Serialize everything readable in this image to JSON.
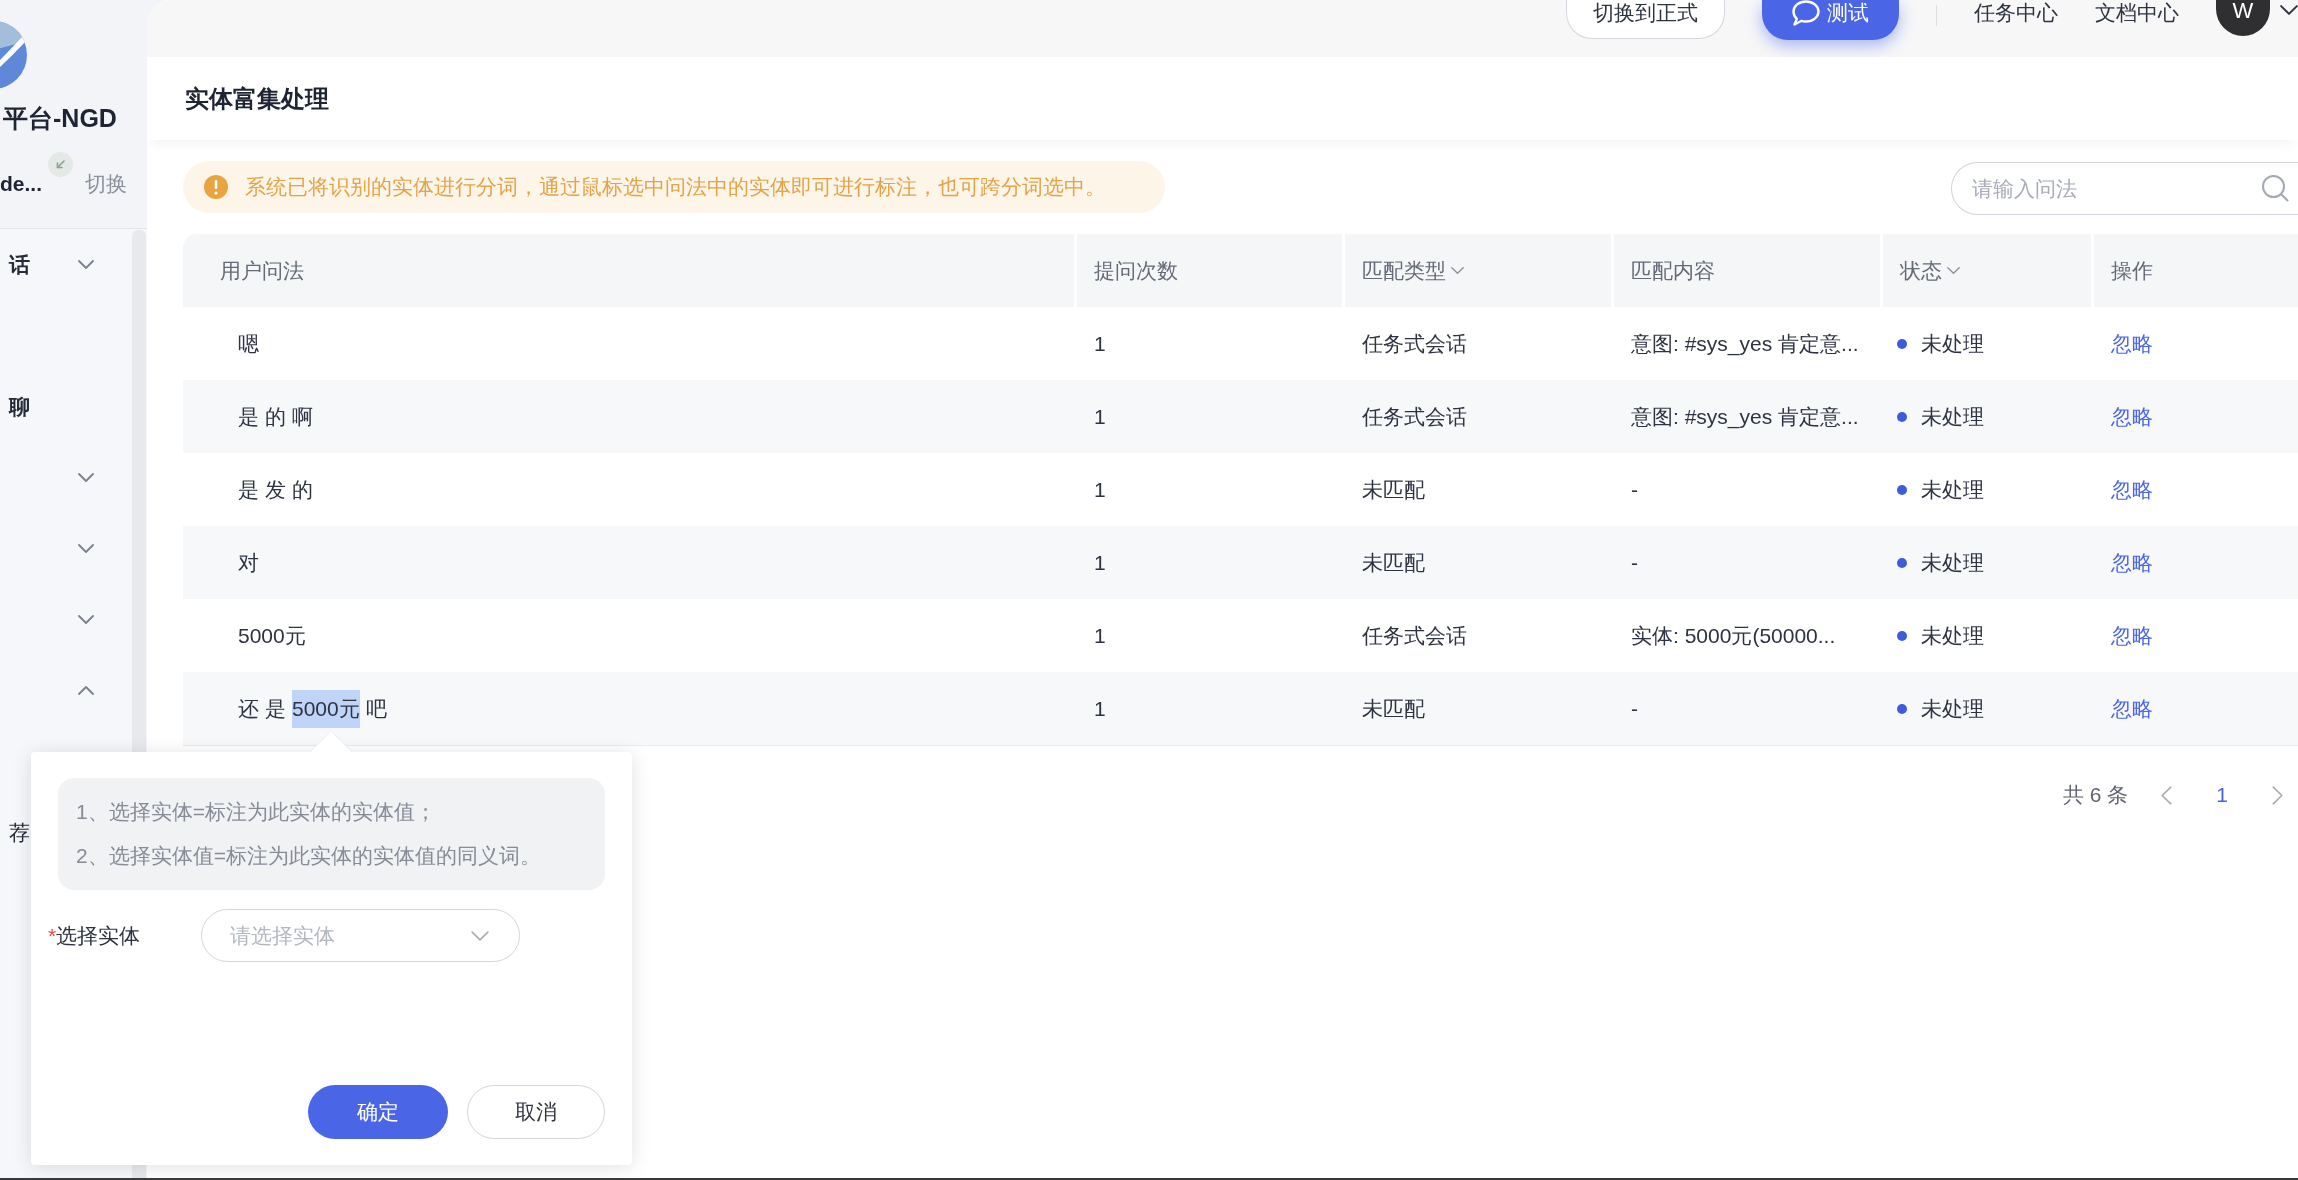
{
  "sidebar": {
    "app_name": "平台-NGD",
    "bot_name": "de...",
    "switch_label": "切换",
    "menu": [
      {
        "label": "话",
        "expanded": false
      },
      {
        "label": "聊"
      },
      {
        "expanded": false
      },
      {
        "expanded": false
      },
      {
        "expanded": false
      },
      {
        "expanded": true,
        "children": [
          {
            "label": "荐"
          }
        ]
      }
    ]
  },
  "header": {
    "buttons": [
      {
        "label": "切换到正式",
        "kind": "outline"
      },
      {
        "label": "测试",
        "kind": "primary"
      }
    ],
    "links": [
      "任务中心",
      "文档中心"
    ],
    "avatar": "W"
  },
  "page": {
    "title": "实体富集处理",
    "notice": "系统已将识别的实体进行分词，通过鼠标选中问法中的实体即可进行标注，也可跨分词选中。",
    "search": {
      "placeholder": "请输入问法"
    }
  },
  "table": {
    "columns": [
      {
        "label": "用户问法",
        "filter": false
      },
      {
        "label": "提问次数",
        "filter": false
      },
      {
        "label": "匹配类型",
        "filter": true
      },
      {
        "label": "匹配内容",
        "filter": false
      },
      {
        "label": "状态",
        "filter": true
      },
      {
        "label": "操作",
        "filter": false
      }
    ],
    "rows": [
      {
        "tokens": [
          {
            "text": "嗯",
            "selected": false
          }
        ],
        "count": "1",
        "match_type": "任务式会话",
        "match_content": "意图: #sys_yes 肯定意...",
        "status": "未处理",
        "action": "忽略"
      },
      {
        "tokens": [
          {
            "text": "是",
            "selected": false
          },
          {
            "text": "的",
            "selected": false
          },
          {
            "text": "啊",
            "selected": false
          }
        ],
        "count": "1",
        "match_type": "任务式会话",
        "match_content": "意图: #sys_yes 肯定意...",
        "status": "未处理",
        "action": "忽略"
      },
      {
        "tokens": [
          {
            "text": "是",
            "selected": false
          },
          {
            "text": "发",
            "selected": false
          },
          {
            "text": "的",
            "selected": false
          }
        ],
        "count": "1",
        "match_type": "未匹配",
        "match_content": "-",
        "status": "未处理",
        "action": "忽略"
      },
      {
        "tokens": [
          {
            "text": "对",
            "selected": false
          }
        ],
        "count": "1",
        "match_type": "未匹配",
        "match_content": "-",
        "status": "未处理",
        "action": "忽略"
      },
      {
        "tokens": [
          {
            "text": "5000元",
            "selected": false
          }
        ],
        "count": "1",
        "match_type": "任务式会话",
        "match_content": "实体: 5000元(50000...",
        "status": "未处理",
        "action": "忽略"
      },
      {
        "tokens": [
          {
            "text": "还",
            "selected": false
          },
          {
            "text": "是",
            "selected": false
          },
          {
            "text": "5000元",
            "selected": true
          },
          {
            "text": "吧",
            "selected": false
          }
        ],
        "count": "1",
        "match_type": "未匹配",
        "match_content": "-",
        "status": "未处理",
        "action": "忽略"
      }
    ]
  },
  "pagination": {
    "total": "共 6 条",
    "pages": [
      {
        "label": "1",
        "selected": true
      }
    ]
  },
  "popover": {
    "hints": [
      "1、选择实体=标注为此实体的实体值；",
      "2、选择实体值=标注为此实体的实体值的同义词。"
    ],
    "field": {
      "required_mark": "*",
      "label": "选择实体",
      "placeholder": "请选择实体"
    },
    "buttons": [
      {
        "label": "确定",
        "kind": "primary"
      },
      {
        "label": "取消",
        "kind": "outline"
      }
    ]
  }
}
